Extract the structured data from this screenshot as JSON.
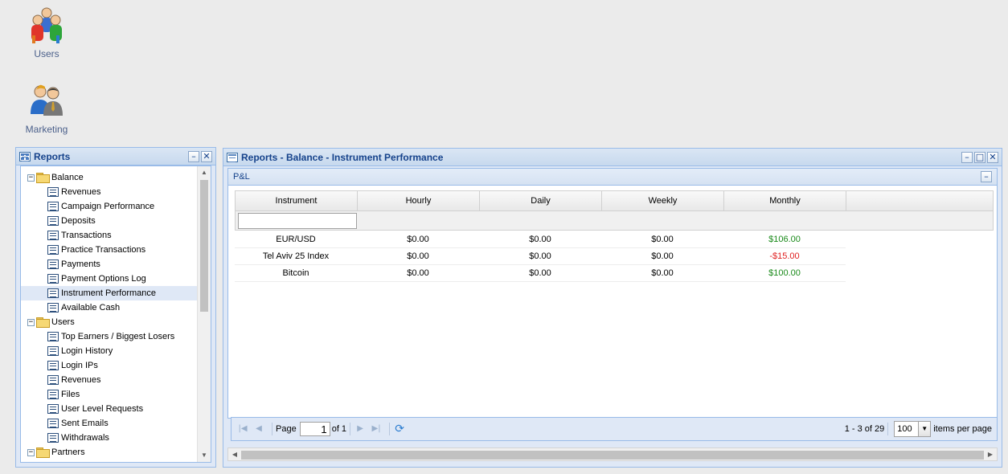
{
  "desktop": {
    "users_label": "Users",
    "marketing_label": "Marketing"
  },
  "reports_panel": {
    "title": "Reports",
    "tree": [
      {
        "type": "folder",
        "label": "Balance"
      },
      {
        "type": "leaf",
        "label": "Revenues"
      },
      {
        "type": "leaf",
        "label": "Campaign Performance"
      },
      {
        "type": "leaf",
        "label": "Deposits"
      },
      {
        "type": "leaf",
        "label": "Transactions"
      },
      {
        "type": "leaf",
        "label": "Practice Transactions"
      },
      {
        "type": "leaf",
        "label": "Payments"
      },
      {
        "type": "leaf",
        "label": "Payment Options Log"
      },
      {
        "type": "leaf",
        "label": "Instrument Performance",
        "selected": true
      },
      {
        "type": "leaf",
        "label": "Available Cash"
      },
      {
        "type": "folder",
        "label": "Users"
      },
      {
        "type": "leaf",
        "label": "Top Earners / Biggest Losers"
      },
      {
        "type": "leaf",
        "label": "Login History"
      },
      {
        "type": "leaf",
        "label": "Login IPs"
      },
      {
        "type": "leaf",
        "label": "Revenues"
      },
      {
        "type": "leaf",
        "label": "Files"
      },
      {
        "type": "leaf",
        "label": "User Level Requests"
      },
      {
        "type": "leaf",
        "label": "Sent Emails"
      },
      {
        "type": "leaf",
        "label": "Withdrawals"
      },
      {
        "type": "folder",
        "label": "Partners"
      }
    ]
  },
  "main_window": {
    "title": "Reports - Balance - Instrument Performance",
    "section_title": "P&L",
    "columns": [
      "Instrument",
      "Hourly",
      "Daily",
      "Weekly",
      "Monthly"
    ],
    "filter_value": "",
    "rows": [
      {
        "instrument": "EUR/USD",
        "hourly": "$0.00",
        "daily": "$0.00",
        "weekly": "$0.00",
        "monthly": "$106.00",
        "monthly_sign": "pos"
      },
      {
        "instrument": "Tel Aviv 25 Index",
        "hourly": "$0.00",
        "daily": "$0.00",
        "weekly": "$0.00",
        "monthly": "-$15.00",
        "monthly_sign": "neg"
      },
      {
        "instrument": "Bitcoin",
        "hourly": "$0.00",
        "daily": "$0.00",
        "weekly": "$0.00",
        "monthly": "$100.00",
        "monthly_sign": "pos"
      }
    ],
    "pager": {
      "page_label": "Page",
      "page_value": "1",
      "of_label": "of 1",
      "range_text": "1 - 3 of 29",
      "per_page_value": "100",
      "per_page_label": "items per page"
    }
  },
  "colors": {
    "positive": "#1a8a1a",
    "negative": "#e02020",
    "header_text": "#15428b"
  }
}
